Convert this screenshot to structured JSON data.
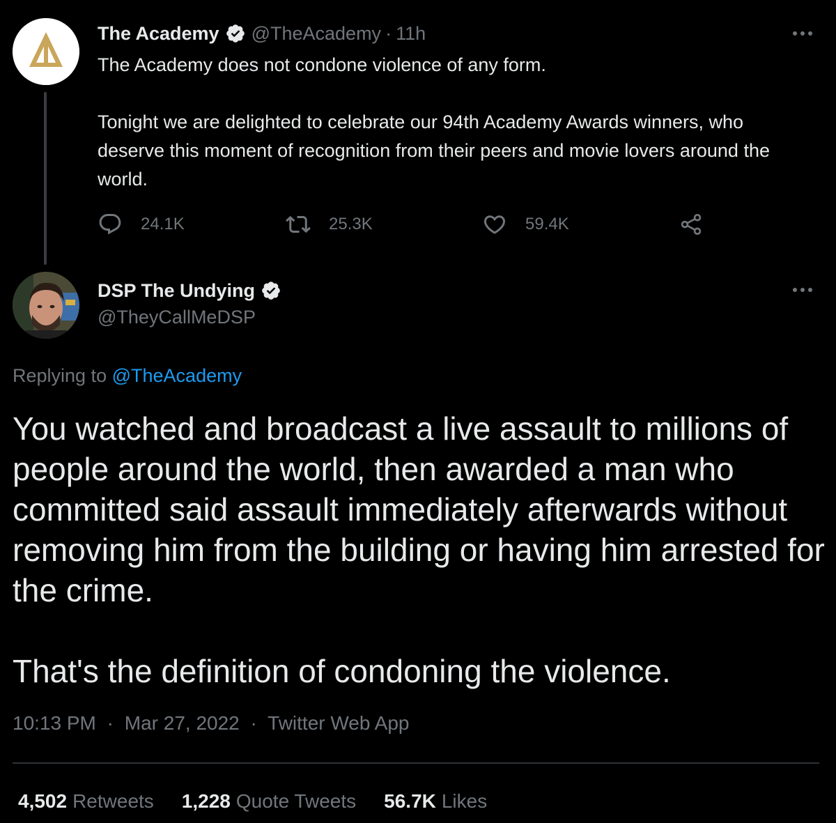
{
  "parent_tweet": {
    "author_name": "The Academy",
    "handle": "@TheAcademy",
    "separator": "·",
    "time": "11h",
    "text_paragraphs": [
      "The Academy does not condone violence of any form.",
      "Tonight we are delighted to celebrate our 94th Academy Awards winners, who deserve this moment of recognition from their peers and movie lovers around the world."
    ],
    "replies": "24.1K",
    "retweets": "25.3K",
    "likes": "59.4K"
  },
  "reply_tweet": {
    "author_name": "DSP The Undying",
    "handle": "@TheyCallMeDSP",
    "replying_label": "Replying to",
    "replying_to": "@TheAcademy",
    "text_paragraphs": [
      "You watched and broadcast a live assault to millions of people around the world, then awarded a man who committed said assault immediately afterwards without removing him from the building or having him arrested for the crime.",
      "That's the definition of condoning the violence."
    ],
    "time": "10:13 PM",
    "sep1": "·",
    "date": "Mar 27, 2022",
    "sep2": "·",
    "source": "Twitter Web App",
    "retweets_count": "4,502",
    "retweets_label": "Retweets",
    "quotes_count": "1,228",
    "quotes_label": "Quote Tweets",
    "likes_count": "56.7K",
    "likes_label": "Likes"
  },
  "colors": {
    "background": "#000000",
    "text_primary": "#e7e9ea",
    "text_secondary": "#71767b",
    "link": "#1d9bf0",
    "verified_badge": "#e7e9ea",
    "academy_gold": "#c9a65a"
  },
  "icons": [
    "verified-badge-icon",
    "more-options-icon",
    "reply-icon",
    "retweet-icon",
    "like-icon",
    "share-icon"
  ]
}
